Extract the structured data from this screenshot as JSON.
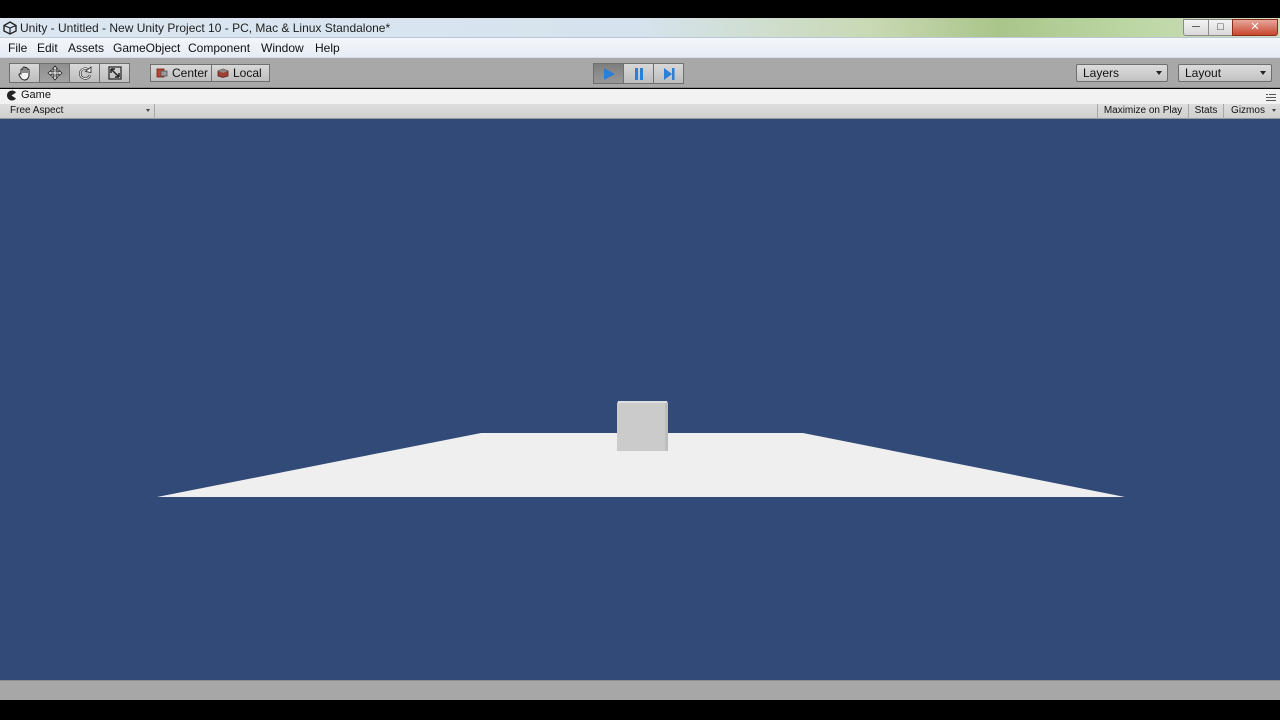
{
  "window": {
    "title": "Unity - Untitled - New Unity Project 10 - PC, Mac & Linux Standalone*",
    "minimize_label": "─",
    "maximize_label": "□",
    "close_label": "✕"
  },
  "menu": {
    "items": [
      "File",
      "Edit",
      "Assets",
      "GameObject",
      "Component",
      "Window",
      "Help"
    ]
  },
  "toolbar": {
    "transform_tools": [
      "hand-icon",
      "move-icon",
      "rotate-icon",
      "scale-icon"
    ],
    "active_tool": "move",
    "pivot_mode_label": "Center",
    "pivot_rotation_label": "Local",
    "play_active": true,
    "layers_label": "Layers",
    "layout_label": "Layout"
  },
  "game_tab": {
    "label": "Game"
  },
  "game_view": {
    "aspect_label": "Free Aspect",
    "maximize_label": "Maximize on Play",
    "stats_label": "Stats",
    "gizmos_label": "Gizmos"
  },
  "colors": {
    "background": "#314a78",
    "plane": "#efefef",
    "cube_front": "#cbcbcb",
    "cube_top": "#dedede",
    "play_accent": "#2a7fd6"
  }
}
